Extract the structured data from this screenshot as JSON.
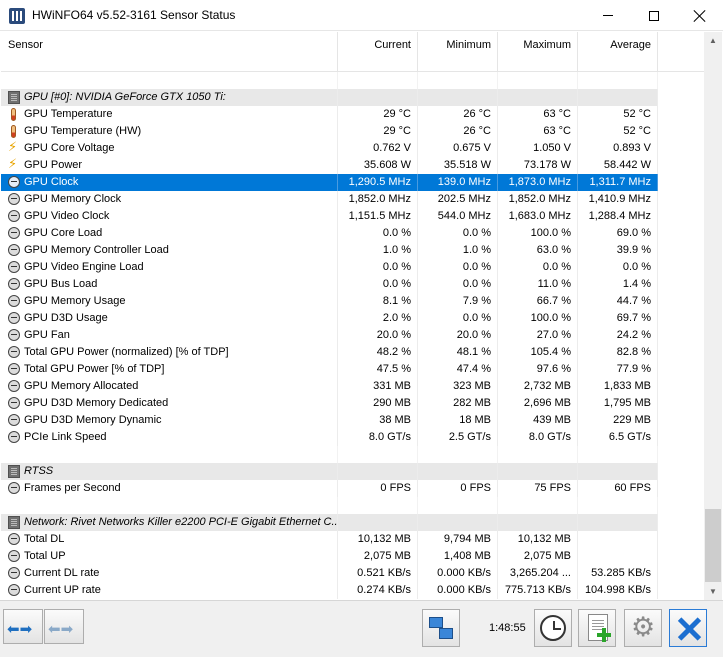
{
  "window": {
    "title": "HWiNFO64 v5.52-3161 Sensor Status"
  },
  "columns": {
    "sensor": "Sensor",
    "current": "Current",
    "minimum": "Minimum",
    "maximum": "Maximum",
    "average": "Average"
  },
  "rows": [
    {
      "type": "blank"
    },
    {
      "type": "group",
      "icon": "chip-icon",
      "name": "GPU [#0]: NVIDIA GeForce GTX 1050 Ti:"
    },
    {
      "type": "sensor",
      "icon": "thermometer-icon",
      "name": "GPU Temperature",
      "current": "29 °C",
      "minimum": "26 °C",
      "maximum": "63 °C",
      "average": "52 °C"
    },
    {
      "type": "sensor",
      "icon": "thermometer-icon",
      "name": "GPU Temperature (HW)",
      "current": "29 °C",
      "minimum": "26 °C",
      "maximum": "63 °C",
      "average": "52 °C"
    },
    {
      "type": "sensor",
      "icon": "lightning-icon",
      "name": "GPU Core Voltage",
      "current": "0.762 V",
      "minimum": "0.675 V",
      "maximum": "1.050 V",
      "average": "0.893 V"
    },
    {
      "type": "sensor",
      "icon": "lightning-icon",
      "name": "GPU Power",
      "current": "35.608 W",
      "minimum": "35.518 W",
      "maximum": "73.178 W",
      "average": "58.442 W"
    },
    {
      "type": "sensor",
      "icon": "gauge-icon",
      "name": "GPU Clock",
      "current": "1,290.5 MHz",
      "minimum": "139.0 MHz",
      "maximum": "1,873.0 MHz",
      "average": "1,311.7 MHz",
      "selected": true
    },
    {
      "type": "sensor",
      "icon": "gauge-icon",
      "name": "GPU Memory Clock",
      "current": "1,852.0 MHz",
      "minimum": "202.5 MHz",
      "maximum": "1,852.0 MHz",
      "average": "1,410.9 MHz"
    },
    {
      "type": "sensor",
      "icon": "gauge-icon",
      "name": "GPU Video Clock",
      "current": "1,151.5 MHz",
      "minimum": "544.0 MHz",
      "maximum": "1,683.0 MHz",
      "average": "1,288.4 MHz"
    },
    {
      "type": "sensor",
      "icon": "gauge-icon",
      "name": "GPU Core Load",
      "current": "0.0 %",
      "minimum": "0.0 %",
      "maximum": "100.0 %",
      "average": "69.0 %"
    },
    {
      "type": "sensor",
      "icon": "gauge-icon",
      "name": "GPU Memory Controller Load",
      "current": "1.0 %",
      "minimum": "1.0 %",
      "maximum": "63.0 %",
      "average": "39.9 %"
    },
    {
      "type": "sensor",
      "icon": "gauge-icon",
      "name": "GPU Video Engine Load",
      "current": "0.0 %",
      "minimum": "0.0 %",
      "maximum": "0.0 %",
      "average": "0.0 %"
    },
    {
      "type": "sensor",
      "icon": "gauge-icon",
      "name": "GPU Bus Load",
      "current": "0.0 %",
      "minimum": "0.0 %",
      "maximum": "11.0 %",
      "average": "1.4 %"
    },
    {
      "type": "sensor",
      "icon": "gauge-icon",
      "name": "GPU Memory Usage",
      "current": "8.1 %",
      "minimum": "7.9 %",
      "maximum": "66.7 %",
      "average": "44.7 %"
    },
    {
      "type": "sensor",
      "icon": "gauge-icon",
      "name": "GPU D3D Usage",
      "current": "2.0 %",
      "minimum": "0.0 %",
      "maximum": "100.0 %",
      "average": "69.7 %"
    },
    {
      "type": "sensor",
      "icon": "gauge-icon",
      "name": "GPU Fan",
      "current": "20.0 %",
      "minimum": "20.0 %",
      "maximum": "27.0 %",
      "average": "24.2 %"
    },
    {
      "type": "sensor",
      "icon": "gauge-icon",
      "name": "Total GPU Power (normalized) [% of TDP]",
      "current": "48.2 %",
      "minimum": "48.1 %",
      "maximum": "105.4 %",
      "average": "82.8 %"
    },
    {
      "type": "sensor",
      "icon": "gauge-icon",
      "name": "Total GPU Power [% of TDP]",
      "current": "47.5 %",
      "minimum": "47.4 %",
      "maximum": "97.6 %",
      "average": "77.9 %"
    },
    {
      "type": "sensor",
      "icon": "gauge-icon",
      "name": "GPU Memory Allocated",
      "current": "331 MB",
      "minimum": "323 MB",
      "maximum": "2,732 MB",
      "average": "1,833 MB"
    },
    {
      "type": "sensor",
      "icon": "gauge-icon",
      "name": "GPU D3D Memory Dedicated",
      "current": "290 MB",
      "minimum": "282 MB",
      "maximum": "2,696 MB",
      "average": "1,795 MB"
    },
    {
      "type": "sensor",
      "icon": "gauge-icon",
      "name": "GPU D3D Memory Dynamic",
      "current": "38 MB",
      "minimum": "18 MB",
      "maximum": "439 MB",
      "average": "229 MB"
    },
    {
      "type": "sensor",
      "icon": "gauge-icon",
      "name": "PCIe Link Speed",
      "current": "8.0 GT/s",
      "minimum": "2.5 GT/s",
      "maximum": "8.0 GT/s",
      "average": "6.5 GT/s"
    },
    {
      "type": "blank"
    },
    {
      "type": "group",
      "icon": "chip-icon",
      "name": "RTSS"
    },
    {
      "type": "sensor",
      "icon": "gauge-icon",
      "name": "Frames per Second",
      "current": "0 FPS",
      "minimum": "0 FPS",
      "maximum": "75 FPS",
      "average": "60 FPS"
    },
    {
      "type": "blank"
    },
    {
      "type": "group",
      "icon": "chip-icon",
      "name": "Network: Rivet Networks Killer e2200 PCI-E Gigabit Ethernet C..."
    },
    {
      "type": "sensor",
      "icon": "gauge-icon",
      "name": "Total DL",
      "current": "10,132 MB",
      "minimum": "9,794 MB",
      "maximum": "10,132 MB",
      "average": ""
    },
    {
      "type": "sensor",
      "icon": "gauge-icon",
      "name": "Total UP",
      "current": "2,075 MB",
      "minimum": "1,408 MB",
      "maximum": "2,075 MB",
      "average": ""
    },
    {
      "type": "sensor",
      "icon": "gauge-icon",
      "name": "Current DL rate",
      "current": "0.521 KB/s",
      "minimum": "0.000 KB/s",
      "maximum": "3,265.204 ...",
      "average": "53.285 KB/s"
    },
    {
      "type": "sensor",
      "icon": "gauge-icon",
      "name": "Current UP rate",
      "current": "0.274 KB/s",
      "minimum": "0.000 KB/s",
      "maximum": "775.713 KB/s",
      "average": "104.998 KB/s"
    }
  ],
  "toolbar": {
    "timer": "1:48:55"
  },
  "colors": {
    "selection": "#0078d7",
    "group_background": "#e8e8e8"
  }
}
